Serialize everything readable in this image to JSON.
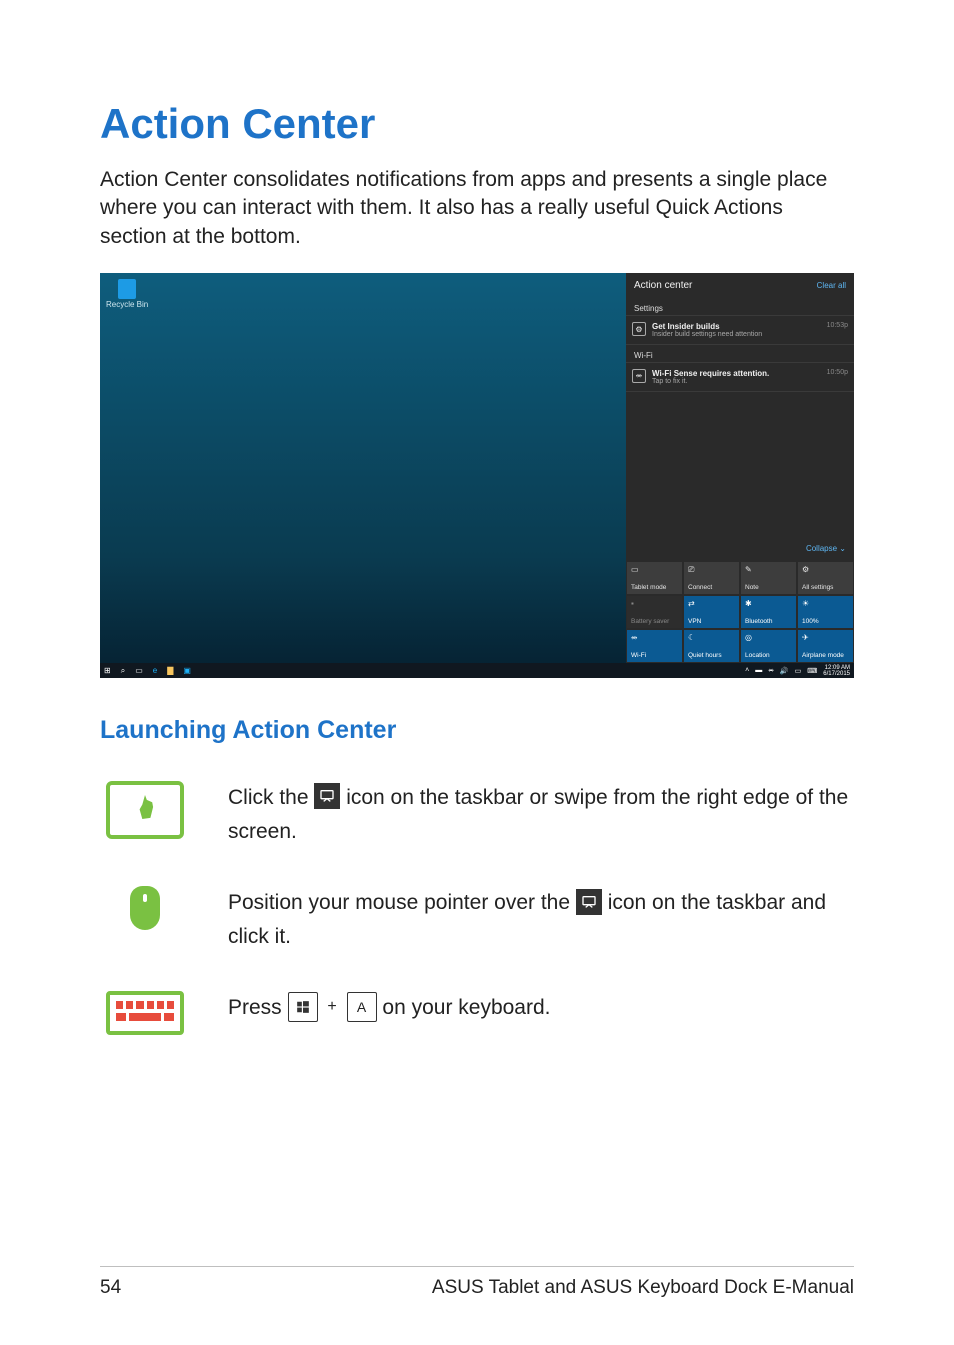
{
  "page": {
    "title": "Action Center",
    "intro": "Action Center consolidates notifications from apps and presents a single place where you can interact with them. It also has a really useful Quick Actions section at the bottom.",
    "subheading": "Launching Action Center",
    "page_number": "54",
    "footer_text": "ASUS Tablet and ASUS Keyboard Dock E-Manual"
  },
  "screenshot": {
    "recycle_label": "Recycle Bin",
    "action_center": {
      "title": "Action center",
      "clear": "Clear all",
      "section_settings": "Settings",
      "notif1": {
        "title": "Get Insider builds",
        "sub": "Insider build settings need attention",
        "time": "10:53p"
      },
      "section_wifi": "Wi-Fi",
      "notif2": {
        "title": "Wi-Fi Sense requires attention.",
        "sub": "Tap to fix it.",
        "time": "10:50p"
      },
      "collapse": "Collapse ⌄",
      "quick_actions": [
        {
          "label": "Tablet mode",
          "icon": "▭",
          "state": "off"
        },
        {
          "label": "Connect",
          "icon": "⎚",
          "state": "off"
        },
        {
          "label": "Note",
          "icon": "✎",
          "state": "off"
        },
        {
          "label": "All settings",
          "icon": "⚙",
          "state": "off"
        },
        {
          "label": "Battery saver",
          "icon": "▪",
          "state": "dim"
        },
        {
          "label": "VPN",
          "icon": "⇄",
          "state": "on"
        },
        {
          "label": "Bluetooth",
          "icon": "✱",
          "state": "on"
        },
        {
          "label": "100%",
          "icon": "☀",
          "state": "on"
        },
        {
          "label": "Wi-Fi",
          "icon": "⥈",
          "state": "on"
        },
        {
          "label": "Quiet hours",
          "icon": "☾",
          "state": "on"
        },
        {
          "label": "Location",
          "icon": "◎",
          "state": "on"
        },
        {
          "label": "Airplane mode",
          "icon": "✈",
          "state": "on"
        }
      ]
    },
    "taskbar": {
      "time": "12:09 AM",
      "date": "6/17/2015"
    }
  },
  "instructions": {
    "touch": {
      "pre": "Click the ",
      "post": " icon on the taskbar or swipe from the right edge of the screen."
    },
    "mouse": {
      "pre": "Position your mouse pointer over the ",
      "post": " icon on the taskbar and click it."
    },
    "keyboard": {
      "pre": "Press ",
      "key2": "A",
      "post": " on your keyboard."
    }
  }
}
